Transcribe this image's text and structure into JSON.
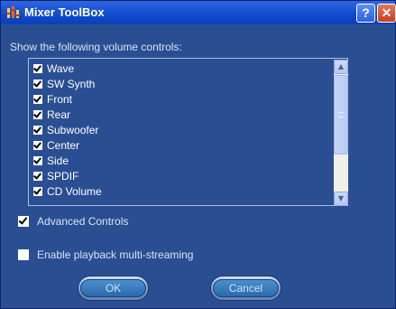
{
  "window": {
    "title": "Mixer ToolBox",
    "help_glyph": "?",
    "close_glyph": "✕"
  },
  "heading": "Show the following volume controls:",
  "controls": [
    {
      "label": "Wave",
      "checked": true
    },
    {
      "label": "SW Synth",
      "checked": true
    },
    {
      "label": "Front",
      "checked": true
    },
    {
      "label": "Rear",
      "checked": true
    },
    {
      "label": "Subwoofer",
      "checked": true
    },
    {
      "label": "Center",
      "checked": true
    },
    {
      "label": "Side",
      "checked": true
    },
    {
      "label": "SPDIF",
      "checked": true
    },
    {
      "label": "CD Volume",
      "checked": true
    }
  ],
  "options": {
    "advanced": {
      "label": "Advanced Controls",
      "checked": true
    },
    "multistream": {
      "label": "Enable playback multi-streaming",
      "checked": false
    }
  },
  "buttons": {
    "ok": "OK",
    "cancel": "Cancel"
  },
  "icons": {
    "app": "mixer-app-icon",
    "scroll_up": "▲",
    "scroll_down": "▼"
  },
  "colors": {
    "title_bar": "#1c55d8",
    "client_bg": "#2a4e92",
    "close_button": "#c8401e"
  }
}
